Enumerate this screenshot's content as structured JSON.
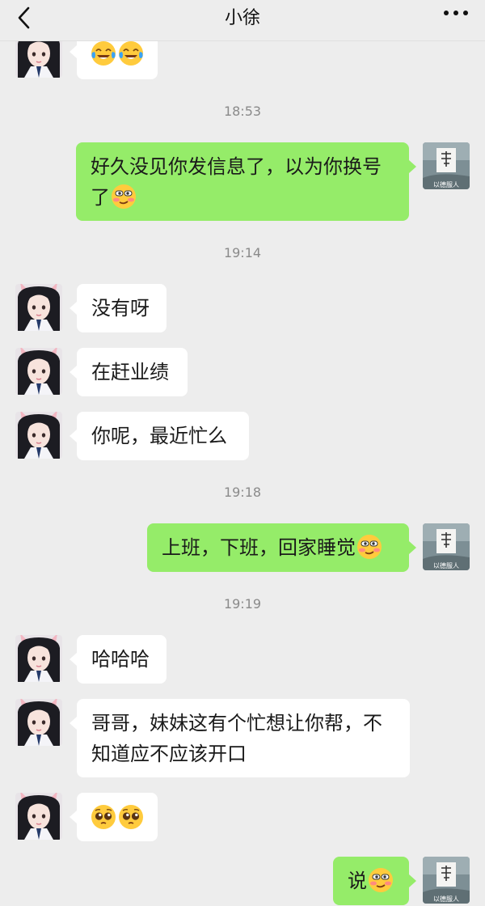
{
  "header": {
    "title": "小徐",
    "back_icon": "chevron-left-icon",
    "more_icon": "ellipsis-icon"
  },
  "colors": {
    "background": "#ededed",
    "incoming_bubble": "#ffffff",
    "outgoing_bubble": "#95ec69",
    "timestamp": "#8a8a8a"
  },
  "self_avatar": {
    "caption": "以德服人",
    "glyph": "德"
  },
  "messages": [
    {
      "side": "in",
      "emojis": [
        "laugh-cry-emoji",
        "laugh-cry-emoji"
      ]
    },
    {
      "type": "time",
      "text": "18:53"
    },
    {
      "side": "out",
      "text": "好久没见你发信息了，以为你换号了",
      "emoji": "smirk-emoji"
    },
    {
      "type": "time",
      "text": "19:14"
    },
    {
      "side": "in",
      "text": "没有呀"
    },
    {
      "side": "in",
      "text": "在赶业绩"
    },
    {
      "side": "in",
      "text": "你呢，最近忙么"
    },
    {
      "type": "time",
      "text": "19:18"
    },
    {
      "side": "out",
      "text": "上班，下班，回家睡觉",
      "emoji": "smirk-emoji"
    },
    {
      "type": "time",
      "text": "19:19"
    },
    {
      "side": "in",
      "text": "哈哈哈"
    },
    {
      "side": "in",
      "text": "哥哥，妹妹这有个忙想让你帮，不知道应不应该开口"
    },
    {
      "side": "in",
      "emojis": [
        "pleading-emoji",
        "pleading-emoji"
      ]
    },
    {
      "side": "out",
      "text": "说",
      "emoji": "smirk-emoji"
    }
  ],
  "texts": {
    "m2_line1": "好久没见你发信息了，以为你换号",
    "m2_line2": "了",
    "m11_line1": "哥哥，妹妹这有个忙想让你帮，不",
    "m11_line2": "知道应不应该开口"
  }
}
